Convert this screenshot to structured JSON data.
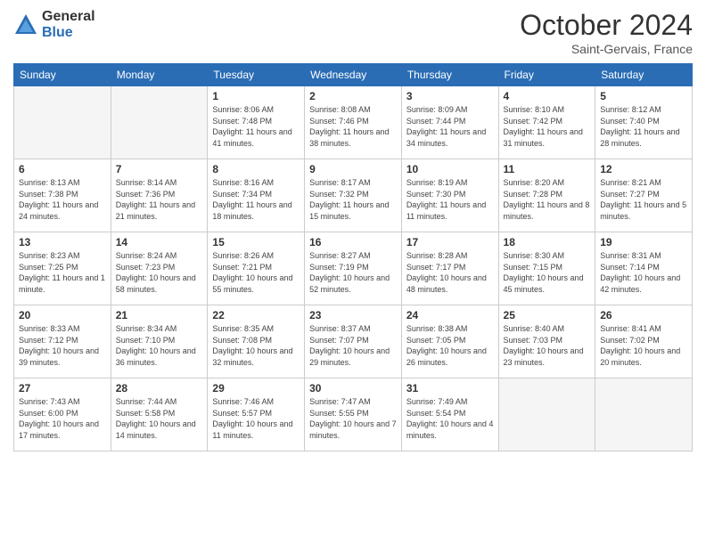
{
  "header": {
    "logo_general": "General",
    "logo_blue": "Blue",
    "month_title": "October 2024",
    "location": "Saint-Gervais, France"
  },
  "days_of_week": [
    "Sunday",
    "Monday",
    "Tuesday",
    "Wednesday",
    "Thursday",
    "Friday",
    "Saturday"
  ],
  "weeks": [
    [
      {
        "day": "",
        "info": ""
      },
      {
        "day": "",
        "info": ""
      },
      {
        "day": "1",
        "info": "Sunrise: 8:06 AM\nSunset: 7:48 PM\nDaylight: 11 hours and 41 minutes."
      },
      {
        "day": "2",
        "info": "Sunrise: 8:08 AM\nSunset: 7:46 PM\nDaylight: 11 hours and 38 minutes."
      },
      {
        "day": "3",
        "info": "Sunrise: 8:09 AM\nSunset: 7:44 PM\nDaylight: 11 hours and 34 minutes."
      },
      {
        "day": "4",
        "info": "Sunrise: 8:10 AM\nSunset: 7:42 PM\nDaylight: 11 hours and 31 minutes."
      },
      {
        "day": "5",
        "info": "Sunrise: 8:12 AM\nSunset: 7:40 PM\nDaylight: 11 hours and 28 minutes."
      }
    ],
    [
      {
        "day": "6",
        "info": "Sunrise: 8:13 AM\nSunset: 7:38 PM\nDaylight: 11 hours and 24 minutes."
      },
      {
        "day": "7",
        "info": "Sunrise: 8:14 AM\nSunset: 7:36 PM\nDaylight: 11 hours and 21 minutes."
      },
      {
        "day": "8",
        "info": "Sunrise: 8:16 AM\nSunset: 7:34 PM\nDaylight: 11 hours and 18 minutes."
      },
      {
        "day": "9",
        "info": "Sunrise: 8:17 AM\nSunset: 7:32 PM\nDaylight: 11 hours and 15 minutes."
      },
      {
        "day": "10",
        "info": "Sunrise: 8:19 AM\nSunset: 7:30 PM\nDaylight: 11 hours and 11 minutes."
      },
      {
        "day": "11",
        "info": "Sunrise: 8:20 AM\nSunset: 7:28 PM\nDaylight: 11 hours and 8 minutes."
      },
      {
        "day": "12",
        "info": "Sunrise: 8:21 AM\nSunset: 7:27 PM\nDaylight: 11 hours and 5 minutes."
      }
    ],
    [
      {
        "day": "13",
        "info": "Sunrise: 8:23 AM\nSunset: 7:25 PM\nDaylight: 11 hours and 1 minute."
      },
      {
        "day": "14",
        "info": "Sunrise: 8:24 AM\nSunset: 7:23 PM\nDaylight: 10 hours and 58 minutes."
      },
      {
        "day": "15",
        "info": "Sunrise: 8:26 AM\nSunset: 7:21 PM\nDaylight: 10 hours and 55 minutes."
      },
      {
        "day": "16",
        "info": "Sunrise: 8:27 AM\nSunset: 7:19 PM\nDaylight: 10 hours and 52 minutes."
      },
      {
        "day": "17",
        "info": "Sunrise: 8:28 AM\nSunset: 7:17 PM\nDaylight: 10 hours and 48 minutes."
      },
      {
        "day": "18",
        "info": "Sunrise: 8:30 AM\nSunset: 7:15 PM\nDaylight: 10 hours and 45 minutes."
      },
      {
        "day": "19",
        "info": "Sunrise: 8:31 AM\nSunset: 7:14 PM\nDaylight: 10 hours and 42 minutes."
      }
    ],
    [
      {
        "day": "20",
        "info": "Sunrise: 8:33 AM\nSunset: 7:12 PM\nDaylight: 10 hours and 39 minutes."
      },
      {
        "day": "21",
        "info": "Sunrise: 8:34 AM\nSunset: 7:10 PM\nDaylight: 10 hours and 36 minutes."
      },
      {
        "day": "22",
        "info": "Sunrise: 8:35 AM\nSunset: 7:08 PM\nDaylight: 10 hours and 32 minutes."
      },
      {
        "day": "23",
        "info": "Sunrise: 8:37 AM\nSunset: 7:07 PM\nDaylight: 10 hours and 29 minutes."
      },
      {
        "day": "24",
        "info": "Sunrise: 8:38 AM\nSunset: 7:05 PM\nDaylight: 10 hours and 26 minutes."
      },
      {
        "day": "25",
        "info": "Sunrise: 8:40 AM\nSunset: 7:03 PM\nDaylight: 10 hours and 23 minutes."
      },
      {
        "day": "26",
        "info": "Sunrise: 8:41 AM\nSunset: 7:02 PM\nDaylight: 10 hours and 20 minutes."
      }
    ],
    [
      {
        "day": "27",
        "info": "Sunrise: 7:43 AM\nSunset: 6:00 PM\nDaylight: 10 hours and 17 minutes."
      },
      {
        "day": "28",
        "info": "Sunrise: 7:44 AM\nSunset: 5:58 PM\nDaylight: 10 hours and 14 minutes."
      },
      {
        "day": "29",
        "info": "Sunrise: 7:46 AM\nSunset: 5:57 PM\nDaylight: 10 hours and 11 minutes."
      },
      {
        "day": "30",
        "info": "Sunrise: 7:47 AM\nSunset: 5:55 PM\nDaylight: 10 hours and 7 minutes."
      },
      {
        "day": "31",
        "info": "Sunrise: 7:49 AM\nSunset: 5:54 PM\nDaylight: 10 hours and 4 minutes."
      },
      {
        "day": "",
        "info": ""
      },
      {
        "day": "",
        "info": ""
      }
    ]
  ]
}
